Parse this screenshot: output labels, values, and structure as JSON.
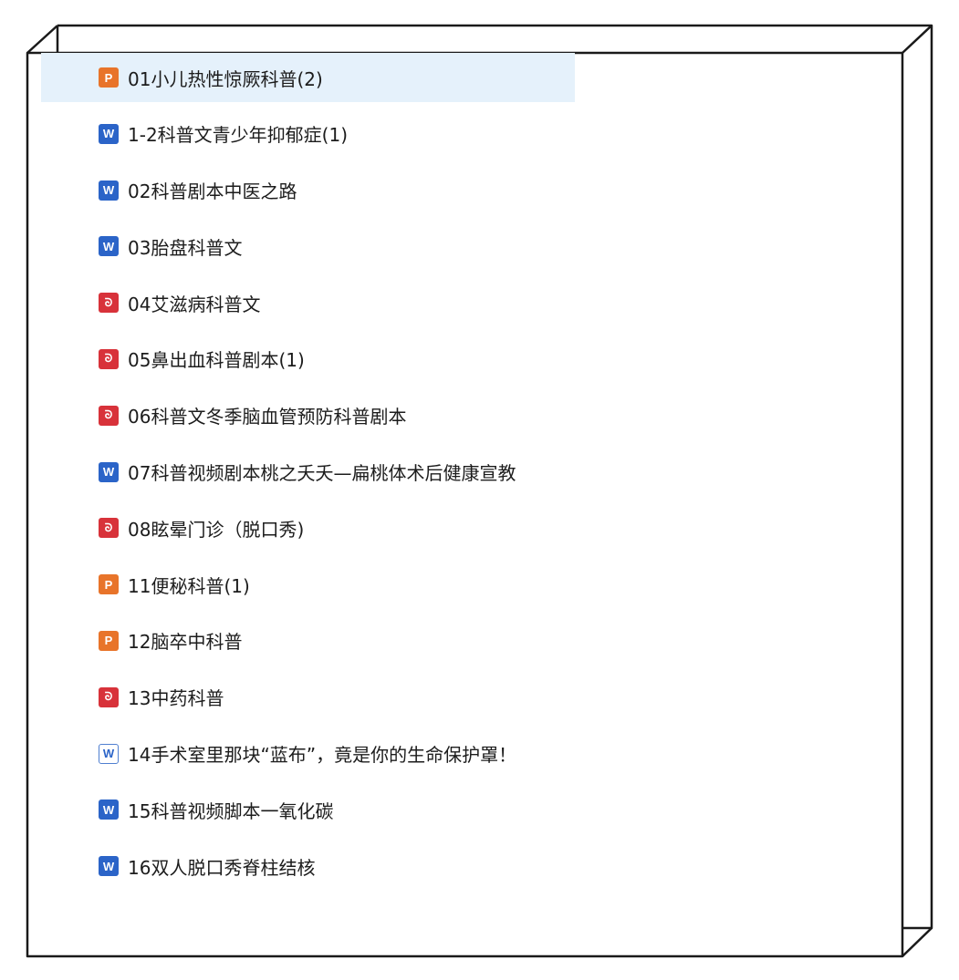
{
  "files": [
    {
      "type": "ppt",
      "icon": "powerpoint-file-icon",
      "glyph": "P",
      "name": "01小儿热性惊厥科普(2)",
      "selected": true
    },
    {
      "type": "word",
      "icon": "word-file-icon",
      "glyph": "W",
      "name": "1-2科普文青少年抑郁症(1)"
    },
    {
      "type": "word",
      "icon": "word-file-icon",
      "glyph": "W",
      "name": "02科普剧本中医之路"
    },
    {
      "type": "word",
      "icon": "word-file-icon",
      "glyph": "W",
      "name": "03胎盘科普文"
    },
    {
      "type": "pdf",
      "icon": "pdf-file-icon",
      "glyph": "ᘐ",
      "name": "04艾滋病科普文"
    },
    {
      "type": "pdf",
      "icon": "pdf-file-icon",
      "glyph": "ᘐ",
      "name": "05鼻出血科普剧本(1)"
    },
    {
      "type": "pdf",
      "icon": "pdf-file-icon",
      "glyph": "ᘐ",
      "name": "06科普文冬季脑血管预防科普剧本"
    },
    {
      "type": "word",
      "icon": "word-file-icon",
      "glyph": "W",
      "name": "07科普视频剧本桃之夭夭—扁桃体术后健康宣教"
    },
    {
      "type": "pdf",
      "icon": "pdf-file-icon",
      "glyph": "ᘐ",
      "name": "08眩晕门诊（脱口秀)"
    },
    {
      "type": "ppt",
      "icon": "powerpoint-file-icon",
      "glyph": "P",
      "name": "11便秘科普(1)"
    },
    {
      "type": "ppt",
      "icon": "powerpoint-file-icon",
      "glyph": "P",
      "name": "12脑卒中科普"
    },
    {
      "type": "pdf",
      "icon": "pdf-file-icon",
      "glyph": "ᘐ",
      "name": "13中药科普"
    },
    {
      "type": "word-outline",
      "icon": "word-document-outline-icon",
      "glyph": "W",
      "name": "14手术室里那块“蓝布”，竟是你的生命保护罩！"
    },
    {
      "type": "word",
      "icon": "word-file-icon",
      "glyph": "W",
      "name": "15科普视频脚本一氧化碳"
    },
    {
      "type": "word",
      "icon": "word-file-icon",
      "glyph": "W",
      "name": "16双人脱口秀脊柱结核"
    }
  ],
  "colors": {
    "ppt": "#e8742a",
    "word": "#2b64c8",
    "pdf": "#d8323a",
    "selection": "#e5f1fb",
    "frame": "#1a1a1a"
  }
}
